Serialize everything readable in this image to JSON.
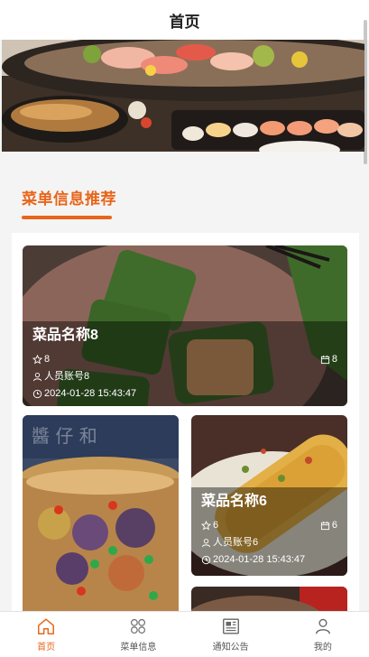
{
  "header": {
    "title": "首页"
  },
  "section": {
    "title": "菜单信息推荐"
  },
  "cards": [
    {
      "name": "菜品名称8",
      "stars": "8",
      "calendar_count": "8",
      "account": "人员账号8",
      "datetime": "2024-01-28 15:43:47"
    },
    {
      "name": "菜品名称6",
      "stars": "6",
      "calendar_count": "6",
      "account": "人员账号6",
      "datetime": "2024-01-28 15:43:47"
    }
  ],
  "tabs": [
    {
      "label": "首页",
      "icon": "home-icon",
      "active": true
    },
    {
      "label": "菜单信息",
      "icon": "grid-icon",
      "active": false
    },
    {
      "label": "通知公告",
      "icon": "newspaper-icon",
      "active": false
    },
    {
      "label": "我的",
      "icon": "user-icon",
      "active": false
    }
  ],
  "colors": {
    "accent": "#e8651a",
    "text": "#222222",
    "tab_inactive": "#555555"
  }
}
